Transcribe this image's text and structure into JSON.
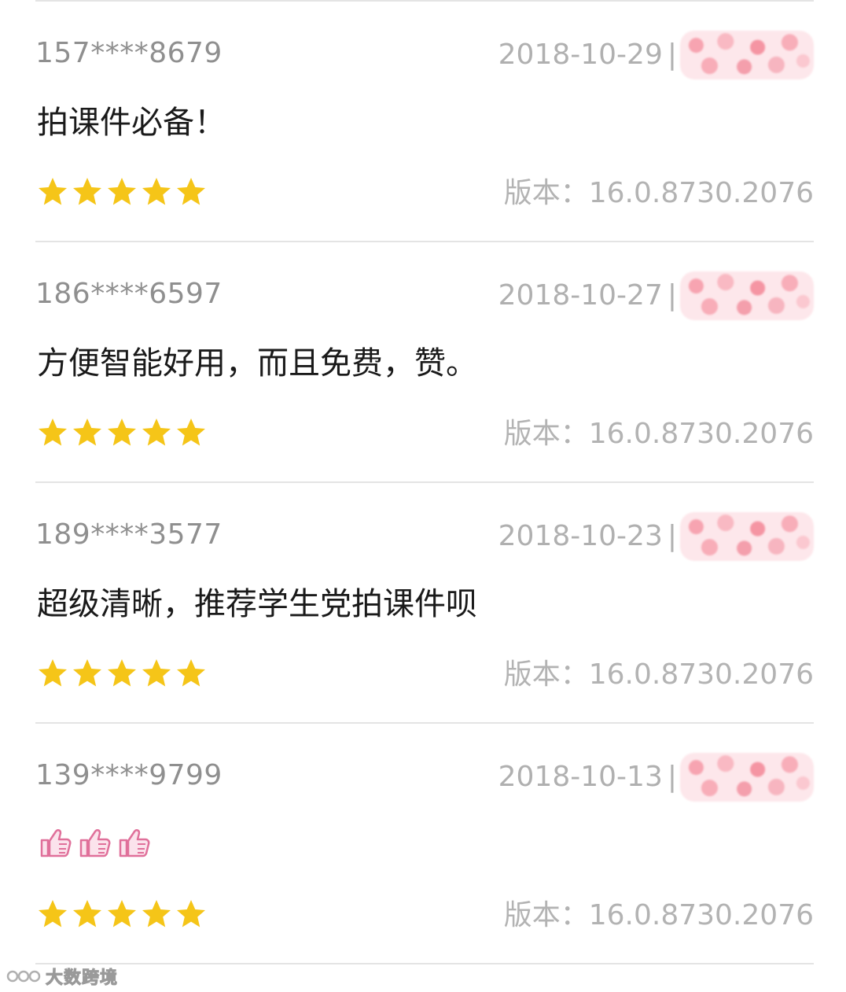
{
  "reviews": [
    {
      "user": "157****8679",
      "date": "2018-10-29",
      "separator": "|",
      "comment": "拍课件必备！",
      "rating": 5,
      "version": "版本：16.0.8730.2076"
    },
    {
      "user": "186****6597",
      "date": "2018-10-27",
      "separator": "|",
      "comment": "方便智能好用，而且免费，赞。",
      "rating": 5,
      "version": "版本：16.0.8730.2076"
    },
    {
      "user": "189****3577",
      "date": "2018-10-23",
      "separator": "|",
      "comment": "超级清晰，推荐学生党拍课件呗",
      "rating": 5,
      "version": "版本：16.0.8730.2076"
    },
    {
      "user": "139****9799",
      "date": "2018-10-13",
      "separator": "|",
      "comment_icons": [
        "thumbs-up-icon",
        "thumbs-up-icon",
        "thumbs-up-icon"
      ],
      "rating": 5,
      "version": "版本：16.0.8730.2076"
    }
  ],
  "watermark": {
    "text": "大数跨境"
  },
  "colors": {
    "star": "#f5c518",
    "thumb": "#e0709a",
    "divider": "#e4e4e4"
  }
}
